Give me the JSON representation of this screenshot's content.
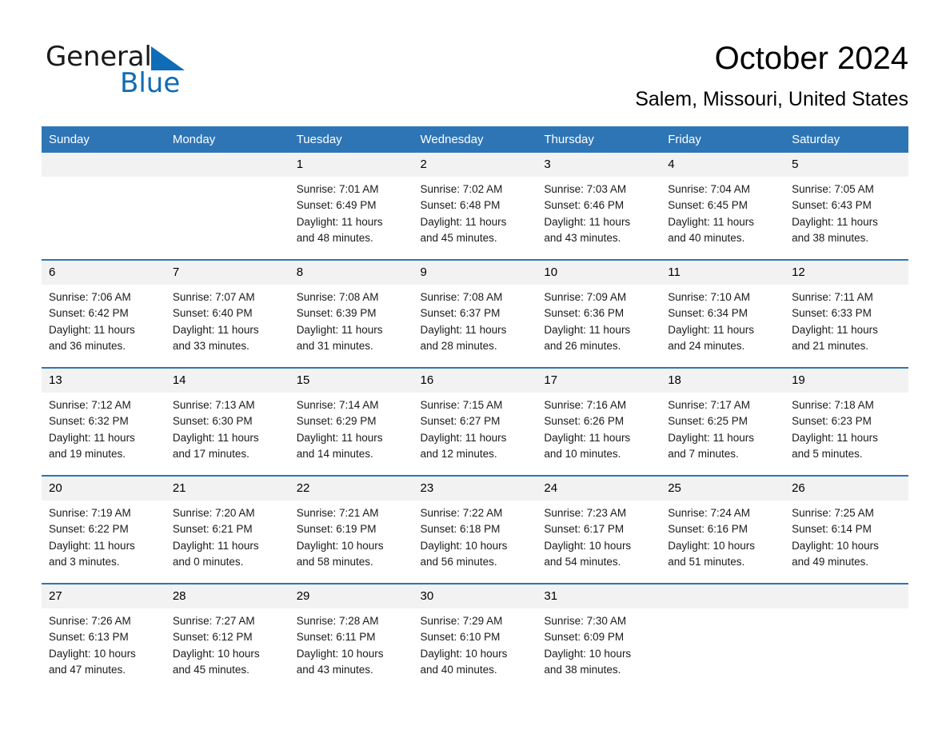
{
  "brand": {
    "name_part1": "General",
    "name_part2": "Blue",
    "accent_color": "#0f6cb6",
    "triangle_icon": "brand-triangle-icon"
  },
  "header": {
    "title": "October 2024",
    "subtitle": "Salem, Missouri, United States"
  },
  "theme": {
    "header_blue": "#2e75b6",
    "daynum_band": "#f2f2f2",
    "text": "#000000"
  },
  "calendar": {
    "weekday_headers": [
      "Sunday",
      "Monday",
      "Tuesday",
      "Wednesday",
      "Thursday",
      "Friday",
      "Saturday"
    ],
    "weeks": [
      [
        {
          "day": "",
          "lines": []
        },
        {
          "day": "",
          "lines": []
        },
        {
          "day": "1",
          "lines": [
            "Sunrise: 7:01 AM",
            "Sunset: 6:49 PM",
            "Daylight: 11 hours",
            "and 48 minutes."
          ]
        },
        {
          "day": "2",
          "lines": [
            "Sunrise: 7:02 AM",
            "Sunset: 6:48 PM",
            "Daylight: 11 hours",
            "and 45 minutes."
          ]
        },
        {
          "day": "3",
          "lines": [
            "Sunrise: 7:03 AM",
            "Sunset: 6:46 PM",
            "Daylight: 11 hours",
            "and 43 minutes."
          ]
        },
        {
          "day": "4",
          "lines": [
            "Sunrise: 7:04 AM",
            "Sunset: 6:45 PM",
            "Daylight: 11 hours",
            "and 40 minutes."
          ]
        },
        {
          "day": "5",
          "lines": [
            "Sunrise: 7:05 AM",
            "Sunset: 6:43 PM",
            "Daylight: 11 hours",
            "and 38 minutes."
          ]
        }
      ],
      [
        {
          "day": "6",
          "lines": [
            "Sunrise: 7:06 AM",
            "Sunset: 6:42 PM",
            "Daylight: 11 hours",
            "and 36 minutes."
          ]
        },
        {
          "day": "7",
          "lines": [
            "Sunrise: 7:07 AM",
            "Sunset: 6:40 PM",
            "Daylight: 11 hours",
            "and 33 minutes."
          ]
        },
        {
          "day": "8",
          "lines": [
            "Sunrise: 7:08 AM",
            "Sunset: 6:39 PM",
            "Daylight: 11 hours",
            "and 31 minutes."
          ]
        },
        {
          "day": "9",
          "lines": [
            "Sunrise: 7:08 AM",
            "Sunset: 6:37 PM",
            "Daylight: 11 hours",
            "and 28 minutes."
          ]
        },
        {
          "day": "10",
          "lines": [
            "Sunrise: 7:09 AM",
            "Sunset: 6:36 PM",
            "Daylight: 11 hours",
            "and 26 minutes."
          ]
        },
        {
          "day": "11",
          "lines": [
            "Sunrise: 7:10 AM",
            "Sunset: 6:34 PM",
            "Daylight: 11 hours",
            "and 24 minutes."
          ]
        },
        {
          "day": "12",
          "lines": [
            "Sunrise: 7:11 AM",
            "Sunset: 6:33 PM",
            "Daylight: 11 hours",
            "and 21 minutes."
          ]
        }
      ],
      [
        {
          "day": "13",
          "lines": [
            "Sunrise: 7:12 AM",
            "Sunset: 6:32 PM",
            "Daylight: 11 hours",
            "and 19 minutes."
          ]
        },
        {
          "day": "14",
          "lines": [
            "Sunrise: 7:13 AM",
            "Sunset: 6:30 PM",
            "Daylight: 11 hours",
            "and 17 minutes."
          ]
        },
        {
          "day": "15",
          "lines": [
            "Sunrise: 7:14 AM",
            "Sunset: 6:29 PM",
            "Daylight: 11 hours",
            "and 14 minutes."
          ]
        },
        {
          "day": "16",
          "lines": [
            "Sunrise: 7:15 AM",
            "Sunset: 6:27 PM",
            "Daylight: 11 hours",
            "and 12 minutes."
          ]
        },
        {
          "day": "17",
          "lines": [
            "Sunrise: 7:16 AM",
            "Sunset: 6:26 PM",
            "Daylight: 11 hours",
            "and 10 minutes."
          ]
        },
        {
          "day": "18",
          "lines": [
            "Sunrise: 7:17 AM",
            "Sunset: 6:25 PM",
            "Daylight: 11 hours",
            "and 7 minutes."
          ]
        },
        {
          "day": "19",
          "lines": [
            "Sunrise: 7:18 AM",
            "Sunset: 6:23 PM",
            "Daylight: 11 hours",
            "and 5 minutes."
          ]
        }
      ],
      [
        {
          "day": "20",
          "lines": [
            "Sunrise: 7:19 AM",
            "Sunset: 6:22 PM",
            "Daylight: 11 hours",
            "and 3 minutes."
          ]
        },
        {
          "day": "21",
          "lines": [
            "Sunrise: 7:20 AM",
            "Sunset: 6:21 PM",
            "Daylight: 11 hours",
            "and 0 minutes."
          ]
        },
        {
          "day": "22",
          "lines": [
            "Sunrise: 7:21 AM",
            "Sunset: 6:19 PM",
            "Daylight: 10 hours",
            "and 58 minutes."
          ]
        },
        {
          "day": "23",
          "lines": [
            "Sunrise: 7:22 AM",
            "Sunset: 6:18 PM",
            "Daylight: 10 hours",
            "and 56 minutes."
          ]
        },
        {
          "day": "24",
          "lines": [
            "Sunrise: 7:23 AM",
            "Sunset: 6:17 PM",
            "Daylight: 10 hours",
            "and 54 minutes."
          ]
        },
        {
          "day": "25",
          "lines": [
            "Sunrise: 7:24 AM",
            "Sunset: 6:16 PM",
            "Daylight: 10 hours",
            "and 51 minutes."
          ]
        },
        {
          "day": "26",
          "lines": [
            "Sunrise: 7:25 AM",
            "Sunset: 6:14 PM",
            "Daylight: 10 hours",
            "and 49 minutes."
          ]
        }
      ],
      [
        {
          "day": "27",
          "lines": [
            "Sunrise: 7:26 AM",
            "Sunset: 6:13 PM",
            "Daylight: 10 hours",
            "and 47 minutes."
          ]
        },
        {
          "day": "28",
          "lines": [
            "Sunrise: 7:27 AM",
            "Sunset: 6:12 PM",
            "Daylight: 10 hours",
            "and 45 minutes."
          ]
        },
        {
          "day": "29",
          "lines": [
            "Sunrise: 7:28 AM",
            "Sunset: 6:11 PM",
            "Daylight: 10 hours",
            "and 43 minutes."
          ]
        },
        {
          "day": "30",
          "lines": [
            "Sunrise: 7:29 AM",
            "Sunset: 6:10 PM",
            "Daylight: 10 hours",
            "and 40 minutes."
          ]
        },
        {
          "day": "31",
          "lines": [
            "Sunrise: 7:30 AM",
            "Sunset: 6:09 PM",
            "Daylight: 10 hours",
            "and 38 minutes."
          ]
        },
        {
          "day": "",
          "lines": []
        },
        {
          "day": "",
          "lines": []
        }
      ]
    ]
  }
}
